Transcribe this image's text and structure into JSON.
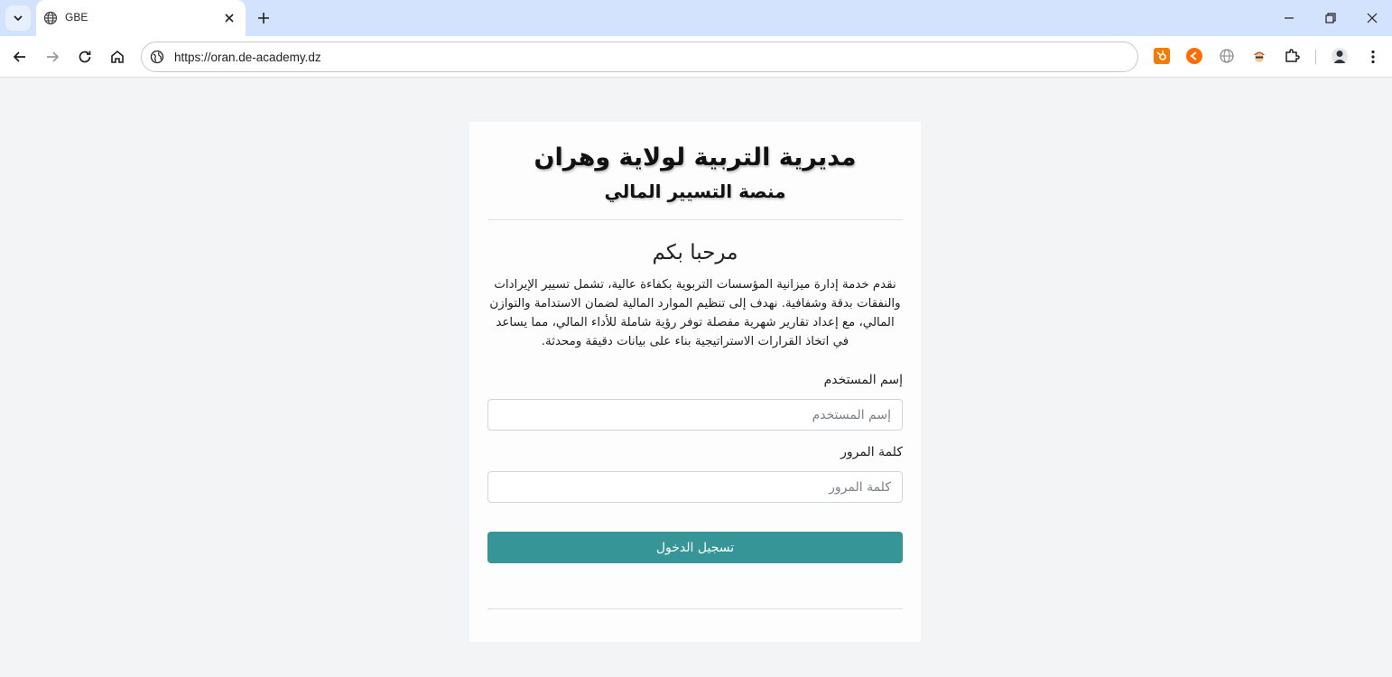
{
  "browser": {
    "tab_title": "GBE",
    "url": "https://oran.de-academy.dz"
  },
  "page": {
    "org_title": "مديرية التربية لولاية وهران",
    "org_subtitle": "منصة التسيير المالي",
    "welcome": "مرحبا بكم",
    "description": "نقدم خدمة إدارة ميزانية المؤسسات التربوية بكفاءة عالية، تشمل تسيير الإيرادات والنفقات بدقة وشفافية. نهدف إلى تنظيم الموارد المالية لضمان الاستدامة والتوازن المالي، مع إعداد تقارير شهرية مفصلة توفر رؤية شاملة للأداء المالي، مما يساعد في اتخاذ القرارات الاستراتيجية بناء على بيانات دقيقة ومحدثة.",
    "username_label": "إسم المستخدم",
    "username_placeholder": "إسم المستخدم",
    "password_label": "كلمة المرور",
    "password_placeholder": "كلمة المرور",
    "login_button": "تسجيل الدخول"
  },
  "colors": {
    "accent": "#359597",
    "tabstrip": "#d3e3fd",
    "page_bg": "#f3f4f5"
  }
}
